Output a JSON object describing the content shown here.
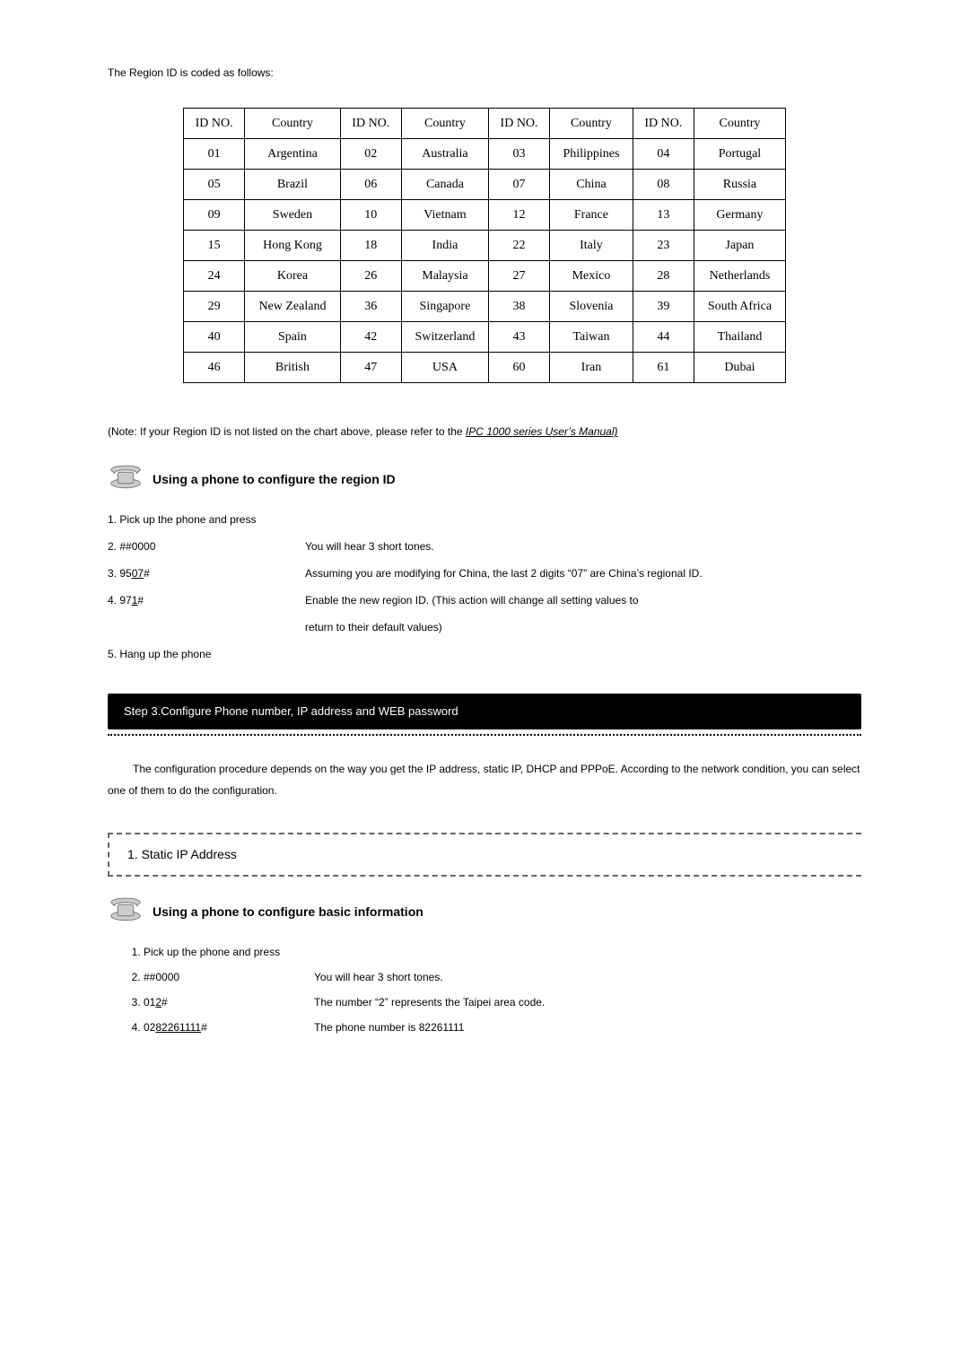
{
  "intro": "The Region ID is coded as follows:",
  "headers": {
    "id": "ID NO.",
    "country": "Country"
  },
  "rows": [
    [
      {
        "id": "01",
        "c": "Argentina"
      },
      {
        "id": "02",
        "c": "Australia"
      },
      {
        "id": "03",
        "c": "Philippines"
      },
      {
        "id": "04",
        "c": "Portugal"
      }
    ],
    [
      {
        "id": "05",
        "c": "Brazil"
      },
      {
        "id": "06",
        "c": "Canada"
      },
      {
        "id": "07",
        "c": "China"
      },
      {
        "id": "08",
        "c": "Russia"
      }
    ],
    [
      {
        "id": "09",
        "c": "Sweden"
      },
      {
        "id": "10",
        "c": "Vietnam"
      },
      {
        "id": "12",
        "c": "France"
      },
      {
        "id": "13",
        "c": "Germany"
      }
    ],
    [
      {
        "id": "15",
        "c": "Hong Kong"
      },
      {
        "id": "18",
        "c": "India"
      },
      {
        "id": "22",
        "c": "Italy"
      },
      {
        "id": "23",
        "c": "Japan"
      }
    ],
    [
      {
        "id": "24",
        "c": "Korea"
      },
      {
        "id": "26",
        "c": "Malaysia"
      },
      {
        "id": "27",
        "c": "Mexico"
      },
      {
        "id": "28",
        "c": "Netherlands"
      }
    ],
    [
      {
        "id": "29",
        "c": "New Zealand"
      },
      {
        "id": "36",
        "c": "Singapore"
      },
      {
        "id": "38",
        "c": "Slovenia"
      },
      {
        "id": "39",
        "c": "South Africa"
      }
    ],
    [
      {
        "id": "40",
        "c": "Spain"
      },
      {
        "id": "42",
        "c": "Switzerland"
      },
      {
        "id": "43",
        "c": "Taiwan"
      },
      {
        "id": "44",
        "c": "Thailand"
      }
    ],
    [
      {
        "id": "46",
        "c": "British"
      },
      {
        "id": "47",
        "c": "USA"
      },
      {
        "id": "60",
        "c": "Iran"
      },
      {
        "id": "61",
        "c": "Dubai"
      }
    ]
  ],
  "note": {
    "prefix": "(Note: ",
    "body": "If your Region ID is not listed on the chart above, please refer to the ",
    "link": "IPC 1000 series User’s Manual)"
  },
  "phone1": "Using a phone to configure the region ID",
  "s1": {
    "a": "1. Pick up the phone and press",
    "b_l": "2. ##0000",
    "b_r": "You will hear 3 short tones.",
    "c_l_pre": "3. 95",
    "c_l_u": "07",
    "c_l_post": "#",
    "c_r": "Assuming you are modifying for China, the last 2 digits “07” are China’s regional ID.",
    "d_l_pre": "4. 97",
    "d_l_u": "1",
    "d_l_post": "#",
    "d_r": "Enable the new region ID. (This action will change all setting values to",
    "d_r2": "return to their default values)",
    "e": "5. Hang up the phone"
  },
  "bar": "Step 3.Configure Phone number, IP address and WEB password",
  "para": "The configuration procedure depends on the way you get the IP address, static IP, DHCP and PPPoE. According to the network condition, you can select one of them to do the configuration.",
  "box": "1. Static IP Address",
  "phone2": "Using a phone to configure basic information",
  "s2": {
    "a": "Pick up the phone and press",
    "b_l": "##0000",
    "b_r": "You will hear 3 short tones.",
    "c_l_pre": "01",
    "c_l_u": "2",
    "c_l_post": "#",
    "c_r": "The number “2” represents the Taipei area code.",
    "d_l_pre": "02",
    "d_l_u": "82261111",
    "d_l_post": "#",
    "d_r": "The phone number is 82261111"
  }
}
